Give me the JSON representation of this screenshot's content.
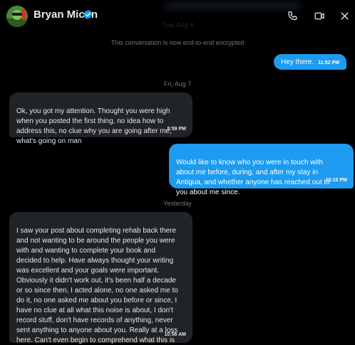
{
  "colors": {
    "background": "#000000",
    "incoming_bubble": "#202327",
    "outgoing_bubble": "#1d9bf0",
    "muted_text": "#71767b",
    "verified": "#1d9bf0"
  },
  "header": {
    "contact_name": "Bryan Micon",
    "verified_icon": "verified-badge-icon",
    "faded_date": "Tue, Aug 4",
    "call_icon": "phone-icon",
    "video_icon": "video-camera-icon",
    "close_icon": "close-icon"
  },
  "thread": {
    "encryption_notice": "This conversation is now end-to-end encrypted",
    "date_fri": "Fri, Aug 7",
    "date_yesterday": "Yesterday",
    "messages": [
      {
        "direction": "outgoing",
        "text": "Hey there.",
        "time": "11:52 PM"
      },
      {
        "direction": "incoming",
        "text": "Ok, you got my attention. Thought you were high\nwhen you posted the first thing, no idea how to\naddress this, no clue why you are going after me,\nwhat's going on man",
        "time": "5:59 PM"
      },
      {
        "direction": "outgoing",
        "text": "Would like to know who you were in touch with\nabout me before, during, and after my stay in\nAntigua, and whether anyone has reached out to\nyou about me since.",
        "time": "10:10 PM"
      },
      {
        "direction": "incoming",
        "text": "I saw your post about completing rehab back there\nand not wanting to be around the people you were\nwith and wanting to complete your book and\ndecided to help. Have always thought your writing\nwas excellent and your goals were important.\nObviously it didn't work out, it's been half a decade\nor so since then, I acted alone, no one asked me to\ndo it, no one asked me about you before or since, I\nhave no clue at all what this noise is about, I don't\nrecord stuff, don't have records of anything, never\nsent anything to anyone about you. Really at a loss\nhere. Can't even begin to comprehend what this is\nall about.",
        "time": "10:56 AM"
      }
    ]
  }
}
